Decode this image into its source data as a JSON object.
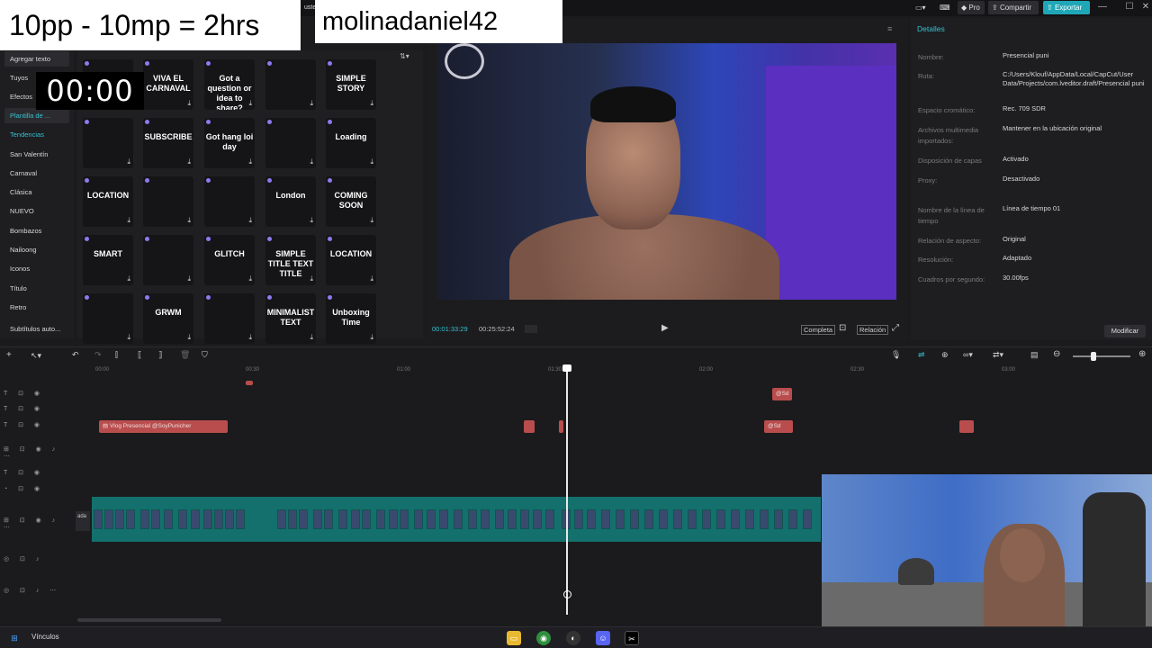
{
  "overlay": {
    "title": "10pp - 10mp = 2hrs",
    "username": "molinadaniel42",
    "timer": "00:00"
  },
  "topbar": {
    "ajuste_partial": "uste",
    "pro": "Pro",
    "share": "Compartir",
    "export": "Exportar"
  },
  "left_panel": {
    "add_text": "Agregar texto",
    "categories": [
      "Tuyos",
      "Efectos",
      "Plantilla de ...",
      "Tendencias",
      "San Valentín",
      "Carnaval",
      "Clásica",
      "NUEVO",
      "Bombazos",
      "Nailoong",
      "Iconos",
      "Título",
      "Retro",
      "Subtítulos auto..."
    ]
  },
  "templates": [
    [
      "",
      "VIVA EL CARNAVAL",
      "Got a question or idea to share?",
      "",
      "SIMPLE STORY"
    ],
    [
      "",
      "SUBSCRIBE",
      "Got hang loi day",
      "",
      "Loading"
    ],
    [
      "LOCATION",
      "",
      "",
      "London",
      "COMING SOON"
    ],
    [
      "SMART",
      "",
      "GLITCH",
      "SIMPLE TITLE TEXT TITLE",
      "LOCATION"
    ],
    [
      "",
      "GRWM",
      "",
      "MINIMALIST TEXT",
      "Unboxing Time"
    ]
  ],
  "player": {
    "current_time": "00:01:33:29",
    "total_time": "00:25:52:24",
    "complete": "Completa",
    "ratio": "Relación"
  },
  "details": {
    "header": "Detalles",
    "rows": [
      {
        "label": "Nombre:",
        "value": "Presencial puni"
      },
      {
        "label": "Ruta:",
        "value": "C:/Users/Klouf/AppData/Local/CapCut/User Data/Projects/com.lveditor.draft/Presencial puni"
      },
      {
        "label": "Espacio cromático:",
        "value": "Rec. 709 SDR"
      },
      {
        "label": "Archivos multimedia importados:",
        "value": "Mantener en la ubicación original"
      },
      {
        "label": "Disposición de capas",
        "value": "Activado"
      },
      {
        "label": "Proxy:",
        "value": "Desactivado"
      },
      {
        "label": "Nombre de la línea de tiempo",
        "value": "Línea de tiempo 01"
      },
      {
        "label": "Relación de aspecto:",
        "value": "Original"
      },
      {
        "label": "Resolución:",
        "value": "Adaptado"
      },
      {
        "label": "Cuadros por segundo:",
        "value": "30.00fps"
      }
    ],
    "modify": "Modificar"
  },
  "timeline": {
    "ticks": [
      "00:00",
      "00:30",
      "01:00",
      "01:30",
      "02:00",
      "02:30",
      "03:00"
    ],
    "text_clip": "Vlog Presencial @SoyPunicher",
    "small_clip_a": "@Sd",
    "small_clip_b": "@Sd",
    "cover_label": "ada"
  },
  "taskbar": {
    "label": "Vínculos"
  }
}
